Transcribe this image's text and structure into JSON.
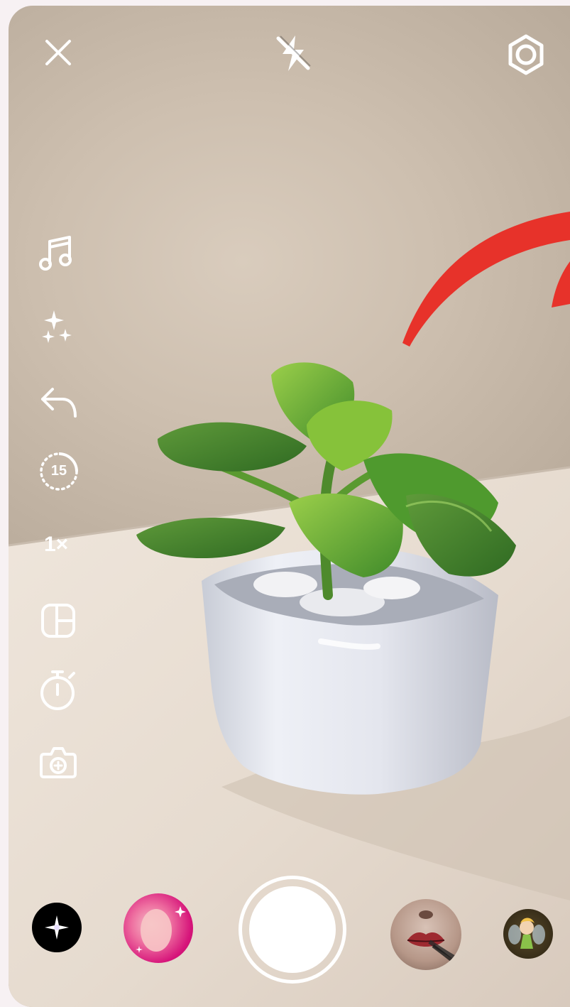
{
  "top_bar": {
    "close": "close-icon",
    "flash": "flash-off-icon",
    "settings": "settings-gear-icon"
  },
  "side_tools": {
    "music": "music-note-icon",
    "effects": "sparkles-icon",
    "undo": "undo-arrow-icon",
    "duration_label": "15",
    "speed_label": "1×",
    "layout": "layout-grid-icon",
    "timer": "timer-icon",
    "dual_camera": "camera-plus-icon"
  },
  "effects_tray": [
    {
      "name": "sparkle-effect"
    },
    {
      "name": "pink-bubble-effect"
    },
    {
      "name": "lips-effect"
    },
    {
      "name": "fairy-effect"
    }
  ],
  "colors": {
    "accent_red": "#e7322a",
    "icon": "#ffffff"
  }
}
